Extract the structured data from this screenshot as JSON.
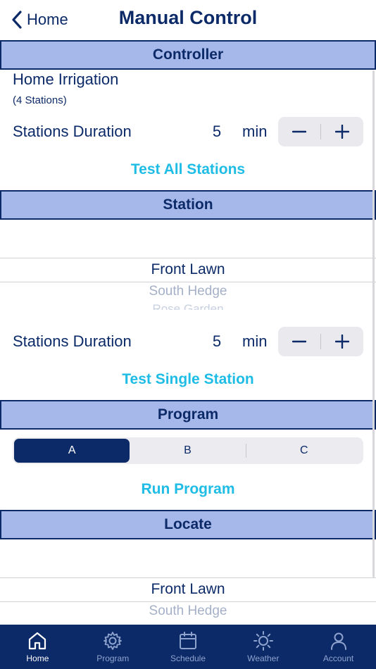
{
  "nav": {
    "back_label": "Home",
    "title": "Manual Control"
  },
  "controller": {
    "header": "Controller",
    "name": "Home Irrigation",
    "stations_count": "(4 Stations)",
    "duration_label": "Stations Duration",
    "duration_value": "5",
    "duration_unit": "min",
    "action": "Test All Stations"
  },
  "station": {
    "header": "Station",
    "picker": {
      "selected": "Front Lawn",
      "next": "South Hedge",
      "next2": "Rose Garden"
    },
    "duration_label": "Stations Duration",
    "duration_value": "5",
    "duration_unit": "min",
    "action": "Test Single Station"
  },
  "program": {
    "header": "Program",
    "segments": [
      "A",
      "B",
      "C"
    ],
    "selected_segment": "A",
    "action": "Run Program"
  },
  "locate": {
    "header": "Locate",
    "picker": {
      "selected": "Front Lawn",
      "next": "South Hedge"
    }
  },
  "tabbar": {
    "items": [
      {
        "label": "Home",
        "icon": "home-icon",
        "active": true
      },
      {
        "label": "Program",
        "icon": "gear-icon",
        "active": false
      },
      {
        "label": "Schedule",
        "icon": "calendar-icon",
        "active": false
      },
      {
        "label": "Weather",
        "icon": "sun-icon",
        "active": false
      },
      {
        "label": "Account",
        "icon": "person-icon",
        "active": false
      }
    ]
  },
  "colors": {
    "primary": "#0c2a68",
    "header_bg": "#a6b8ea",
    "action": "#1fbde6",
    "tab_inactive": "#8fa3cf"
  }
}
